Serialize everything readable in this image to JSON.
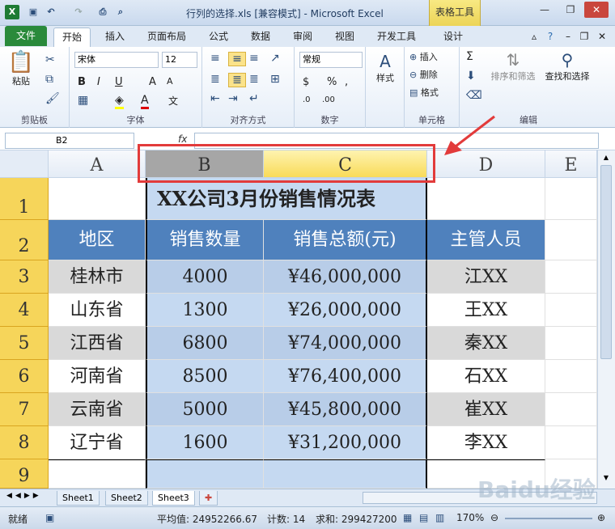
{
  "window": {
    "title": "行列的选择.xls  [兼容模式] - Microsoft Excel",
    "context_tab": "表格工具",
    "app_icon": "excel-icon"
  },
  "tabs": [
    "文件",
    "开始",
    "插入",
    "页面布局",
    "公式",
    "数据",
    "审阅",
    "视图",
    "开发工具",
    "设计"
  ],
  "ribbon": {
    "paste": "粘贴",
    "clipboard": "剪贴板",
    "font_name": "宋体",
    "font_size": "12",
    "font": "字体",
    "align": "对齐方式",
    "number_format": "常规",
    "number": "数字",
    "styles": "样式",
    "insert": "插入",
    "delete": "删除",
    "format": "格式",
    "cells": "单元格",
    "sort_filter": "排序和筛选",
    "find_select": "查找和选择",
    "editing": "编辑"
  },
  "formula_bar": {
    "name_box": "B2",
    "fx": "fx",
    "value": ""
  },
  "columns": [
    "A",
    "B",
    "C",
    "D",
    "E"
  ],
  "rows": [
    "1",
    "2",
    "3",
    "4",
    "5",
    "6",
    "7",
    "8",
    "9"
  ],
  "table": {
    "title": "XX公司3月份销售情况表",
    "headers": [
      "地区",
      "销售数量",
      "销售总额(元)",
      "主管人员"
    ],
    "data": [
      [
        "桂林市",
        "4000",
        "¥46,000,000",
        "江XX"
      ],
      [
        "山东省",
        "1300",
        "¥26,000,000",
        "王XX"
      ],
      [
        "江西省",
        "6800",
        "¥74,000,000",
        "秦XX"
      ],
      [
        "河南省",
        "8500",
        "¥76,400,000",
        "石XX"
      ],
      [
        "云南省",
        "5000",
        "¥45,800,000",
        "崔XX"
      ],
      [
        "辽宁省",
        "1600",
        "¥31,200,000",
        "李XX"
      ]
    ]
  },
  "sheets": [
    "Sheet1",
    "Sheet2",
    "Sheet3"
  ],
  "status": {
    "mode": "就绪",
    "average": "平均值: 24952266.67",
    "count": "计数: 14",
    "sum": "求和: 299427200",
    "zoom": "170%"
  },
  "watermark": "Baidu经验",
  "colors": {
    "header_blue": "#4f81bd",
    "row_gray": "#d9d9d9",
    "sel_blue": "#c5d9f1",
    "annotation": "#e23b3b"
  }
}
